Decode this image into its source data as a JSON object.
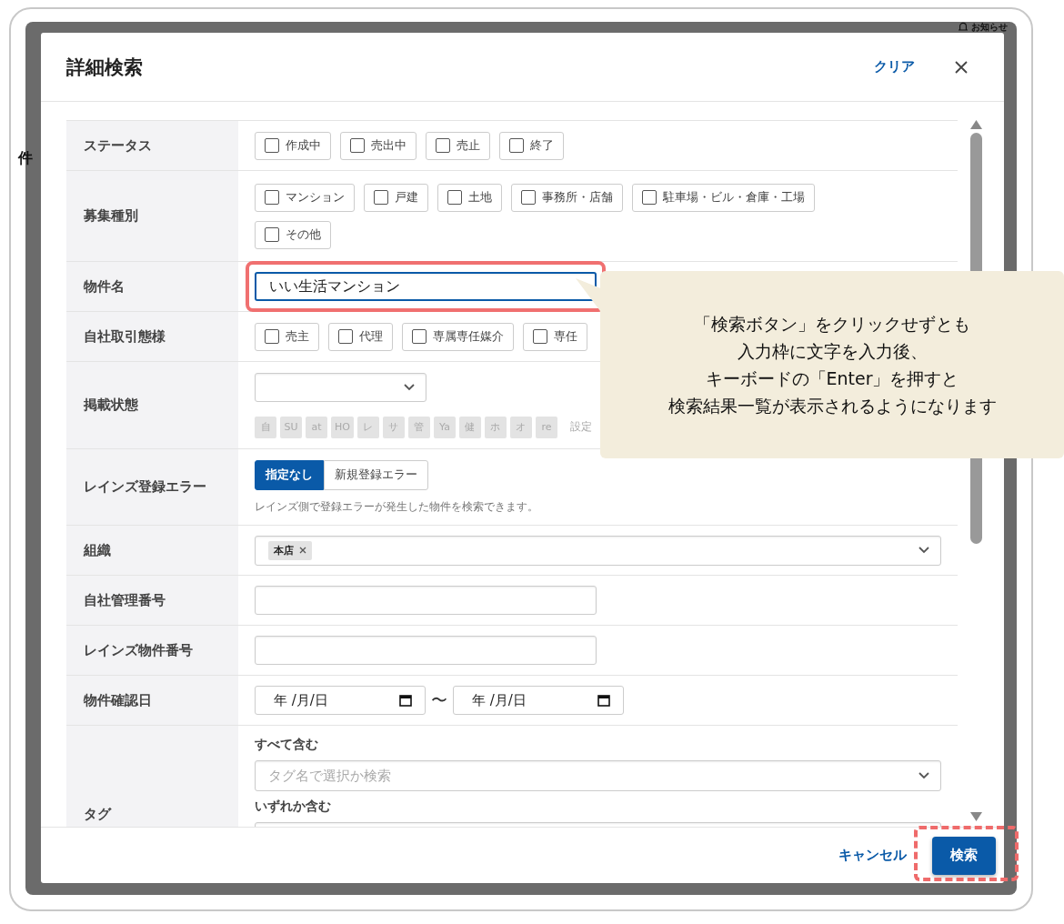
{
  "page": {
    "notice": "お知らせ",
    "count_fragment": "件"
  },
  "dialog": {
    "title": "詳細検索",
    "clear": "クリア"
  },
  "rows": [
    {
      "kind": "checkboxes",
      "label": "ステータス",
      "options": [
        {
          "label": "作成中",
          "checked": false
        },
        {
          "label": "売出中",
          "checked": false
        },
        {
          "label": "売止",
          "checked": false
        },
        {
          "label": "終了",
          "checked": false
        }
      ]
    },
    {
      "kind": "checkboxes",
      "label": "募集種別",
      "options": [
        {
          "label": "マンション",
          "checked": false
        },
        {
          "label": "戸建",
          "checked": false
        },
        {
          "label": "土地",
          "checked": false
        },
        {
          "label": "事務所・店舗",
          "checked": false
        },
        {
          "label": "駐車場・ビル・倉庫・工場",
          "checked": false
        },
        {
          "label": "その他",
          "checked": false
        }
      ]
    },
    {
      "kind": "text",
      "label": "物件名",
      "value": "いい生活マンション",
      "focused": true
    },
    {
      "kind": "checkboxes",
      "label": "自社取引態様",
      "options": [
        {
          "label": "売主",
          "checked": false
        },
        {
          "label": "代理",
          "checked": false
        },
        {
          "label": "専属専任媒介",
          "checked": false
        },
        {
          "label": "専任",
          "checked": false
        }
      ]
    },
    {
      "kind": "select_badges",
      "label": "掲載状態",
      "badges": [
        "自",
        "SU",
        "at",
        "HO",
        "レ",
        "サ",
        "管",
        "Ya",
        "健",
        "ホ",
        "オ",
        "re"
      ],
      "settings": "設定"
    },
    {
      "kind": "toggle",
      "label": "レインズ登録エラー",
      "options": [
        {
          "label": "指定なし",
          "selected": true
        },
        {
          "label": "新規登録エラー",
          "selected": false
        }
      ],
      "hint": "レインズ側で登録エラーが発生した物件を検索できます。"
    },
    {
      "kind": "multiselect",
      "label": "組織",
      "chips": [
        "本店"
      ]
    },
    {
      "kind": "text",
      "label": "自社管理番号",
      "focused": false
    },
    {
      "kind": "text",
      "label": "レインズ物件番号",
      "focused": false
    },
    {
      "kind": "date_range",
      "label": "物件確認日",
      "from": "年 /月/日",
      "separator": "〜",
      "to": "年 /月/日"
    },
    {
      "kind": "tags",
      "label": "タグ",
      "groups": [
        {
          "title": "すべて含む",
          "placeholder": "タグ名で選択か検索"
        },
        {
          "title": "いずれか含む"
        }
      ]
    }
  ],
  "footer": {
    "cancel": "キャンセル",
    "search": "検索"
  },
  "callout": {
    "lines": [
      "「検索ボタン」をクリックせずとも",
      "入力枠に文字を入力後、",
      "キーボードの「Enter」を押すと",
      "検索結果一覧が表示されるようになります"
    ]
  }
}
